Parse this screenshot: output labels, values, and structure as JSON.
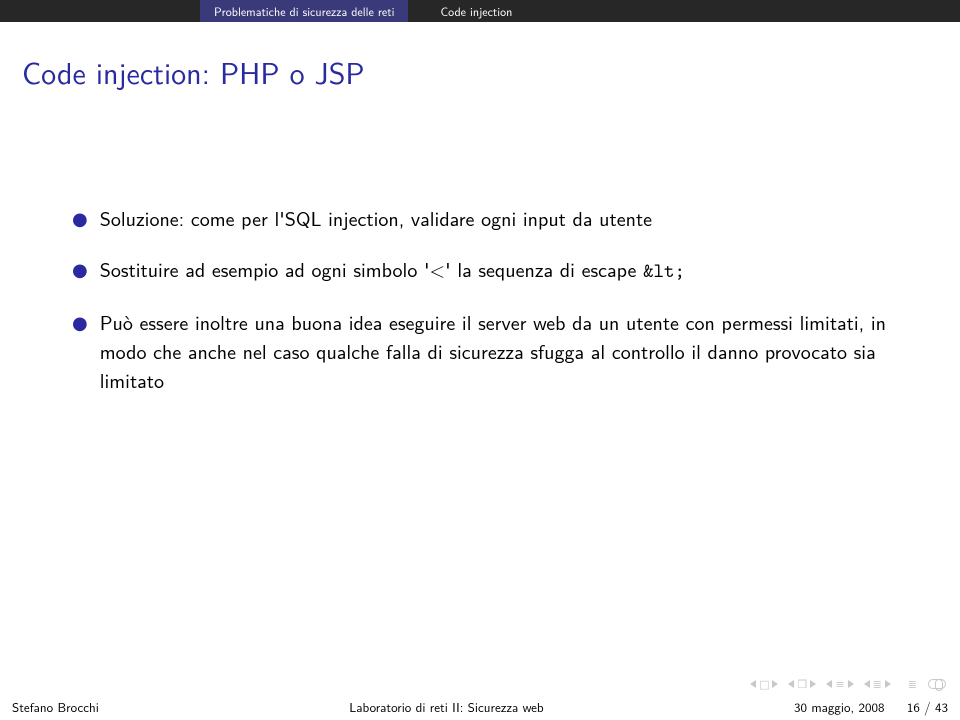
{
  "topbar": {
    "crumb1": "Problematiche di sicurezza delle reti",
    "crumb2": "Code injection"
  },
  "title": "Code injection: PHP o JSP",
  "items": [
    "Soluzione: come per l'SQL injection, validare ogni input da utente",
    "Sostituire ad esempio ad ogni simbolo '<' la sequenza di escape &lt;",
    "Può essere inoltre una buona idea eseguire il server web da un utente con permessi limitati, in modo che anche nel caso qualche falla di sicurezza sfugga al controllo il danno provocato sia limitato"
  ],
  "footer": {
    "author": "Stefano Brocchi",
    "center": "Laboratorio di reti II: Sicurezza web",
    "date": "30 maggio, 2008",
    "page": "16 / 43"
  }
}
